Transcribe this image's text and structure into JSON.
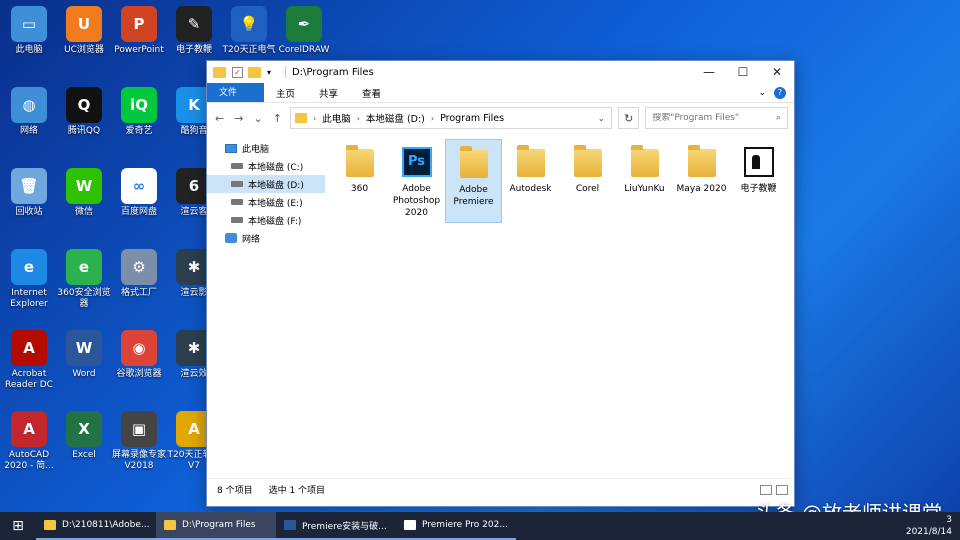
{
  "desktop": {
    "icons": [
      {
        "label": "此电脑",
        "glyph": "▭",
        "color": "#3f8fd8",
        "icon": "this-pc-icon"
      },
      {
        "label": "UC浏览器",
        "glyph": "U",
        "color": "#f07c1e",
        "icon": "uc-browser-icon"
      },
      {
        "label": "PowerPoint",
        "glyph": "P",
        "color": "#d04423",
        "icon": "powerpoint-icon"
      },
      {
        "label": "电子教鞭",
        "glyph": "✎",
        "color": "#222222",
        "icon": "e-pointer-icon"
      },
      {
        "label": "T20天正电气",
        "glyph": "💡",
        "color": "#1f5fbf",
        "icon": "t20-electric-icon"
      },
      {
        "label": "CorelDRAW",
        "glyph": "✒",
        "color": "#1a7b3a",
        "icon": "coreldraw-icon"
      },
      {
        "label": "网络",
        "glyph": "◍",
        "color": "#3f8fd8",
        "icon": "network-icon"
      },
      {
        "label": "腾讯QQ",
        "glyph": "Q",
        "color": "#111111",
        "icon": "qq-icon"
      },
      {
        "label": "爱奇艺",
        "glyph": "iQ",
        "color": "#00c73c",
        "icon": "iqiyi-icon"
      },
      {
        "label": "酷狗音",
        "glyph": "K",
        "color": "#1a8fe8",
        "icon": "kugou-icon"
      },
      {
        "label": "回收站",
        "glyph": "🗑",
        "color": "#6fa8dc",
        "icon": "recycle-bin-icon"
      },
      {
        "label": "微信",
        "glyph": "W",
        "color": "#2dc100",
        "icon": "wechat-icon"
      },
      {
        "label": "百度网盘",
        "glyph": "∞",
        "color": "#ffffff",
        "icon": "baidu-netdisk-icon"
      },
      {
        "label": "渲云客",
        "glyph": "6",
        "color": "#222222",
        "icon": "render-cloud-icon"
      },
      {
        "label": "Internet Explorer",
        "glyph": "e",
        "color": "#1e88e5",
        "icon": "ie-icon"
      },
      {
        "label": "360安全浏览器",
        "glyph": "e",
        "color": "#2bb24c",
        "icon": "360-browser-icon"
      },
      {
        "label": "格式工厂",
        "glyph": "⚙",
        "color": "#7c8ea8",
        "icon": "format-factory-icon"
      },
      {
        "label": "渲云影",
        "glyph": "✱",
        "color": "#2b3f4f",
        "icon": "render-shadow-icon"
      },
      {
        "label": "Acrobat Reader DC",
        "glyph": "A",
        "color": "#b30b00",
        "icon": "acrobat-icon"
      },
      {
        "label": "Word",
        "glyph": "W",
        "color": "#2b579a",
        "icon": "word-icon"
      },
      {
        "label": "谷歌浏览器",
        "glyph": "◉",
        "color": "#db4437",
        "icon": "chrome-icon"
      },
      {
        "label": "渲云效",
        "glyph": "✱",
        "color": "#2b3f4f",
        "icon": "render-effect-icon"
      },
      {
        "label": "AutoCAD 2020 - 简...",
        "glyph": "A",
        "color": "#c1272d",
        "icon": "autocad-icon"
      },
      {
        "label": "Excel",
        "glyph": "X",
        "color": "#217346",
        "icon": "excel-icon"
      },
      {
        "label": "屏幕录像专家V2018",
        "glyph": "▣",
        "color": "#444444",
        "icon": "screen-recorder-icon"
      },
      {
        "label": "T20天正软件V7",
        "glyph": "A",
        "color": "#e0a800",
        "icon": "t20-software-icon"
      }
    ]
  },
  "window": {
    "title": "D:\\Program Files",
    "check_glyph": "✓",
    "arrow_glyph": "▾",
    "min_glyph": "—",
    "max_glyph": "☐",
    "close_glyph": "✕",
    "ribbon_tabs": [
      "文件",
      "主页",
      "共享",
      "查看"
    ],
    "ribbon_collapse": "⌄",
    "help": "?",
    "nav_back": "←",
    "nav_forward": "→",
    "nav_history": "⌄",
    "nav_up": "↑",
    "breadcrumb": [
      "此电脑",
      "本地磁盘 (D:)",
      "Program Files"
    ],
    "chevron": "›",
    "dropdown": "⌄",
    "refresh": "↻",
    "search_placeholder": "搜索\"Program Files\"",
    "search_glyph": "⌕",
    "nav_pane": [
      {
        "label": "此电脑",
        "type": "pc",
        "sub": false,
        "selected": false
      },
      {
        "label": "本地磁盘 (C:)",
        "type": "drive",
        "sub": true,
        "selected": false
      },
      {
        "label": "本地磁盘 (D:)",
        "type": "drive",
        "sub": true,
        "selected": true
      },
      {
        "label": "本地磁盘 (E:)",
        "type": "drive",
        "sub": true,
        "selected": false
      },
      {
        "label": "本地磁盘 (F:)",
        "type": "drive",
        "sub": true,
        "selected": false
      },
      {
        "label": "网络",
        "type": "net",
        "sub": false,
        "selected": false
      }
    ],
    "files": [
      {
        "name": "360",
        "kind": "folder",
        "selected": false
      },
      {
        "name": "Adobe Photoshop 2020",
        "kind": "ps",
        "selected": false
      },
      {
        "name": "Adobe Premiere",
        "kind": "folder",
        "selected": true
      },
      {
        "name": "Autodesk",
        "kind": "folder",
        "selected": false
      },
      {
        "name": "Corel",
        "kind": "folder",
        "selected": false
      },
      {
        "name": "LiuYunKu",
        "kind": "folder",
        "selected": false
      },
      {
        "name": "Maya 2020",
        "kind": "folder",
        "selected": false
      },
      {
        "name": "电子教鞭",
        "kind": "teach",
        "selected": false
      }
    ],
    "status": {
      "count": "8 个项目",
      "selected": "选中 1 个项目"
    }
  },
  "taskbar": {
    "start_glyph": "⊞",
    "items": [
      {
        "label": "D:\\210811\\Adobe...",
        "color": "#f5c542",
        "active": false
      },
      {
        "label": "D:\\Program Files",
        "color": "#f5c542",
        "active": true
      },
      {
        "label": "Premiere安装与破...",
        "color": "#2b579a",
        "active": false
      },
      {
        "label": "Premiere Pro 202...",
        "color": "#ffffff",
        "active": false
      }
    ],
    "time": "3",
    "date": "2021/8/14"
  },
  "watermark": "头条 @放老师讲课堂"
}
